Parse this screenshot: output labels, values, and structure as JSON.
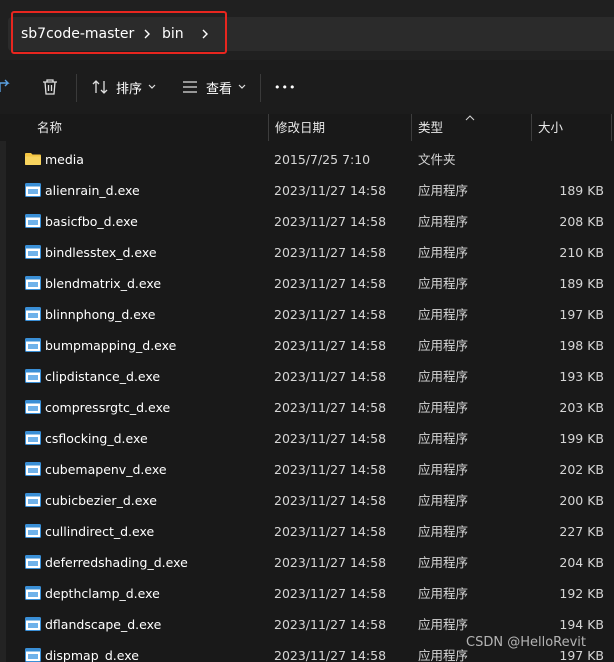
{
  "breadcrumb": {
    "items": [
      "sb7code-master",
      "bin"
    ]
  },
  "toolbar": {
    "sort_label": "排序",
    "view_label": "查看",
    "more_label": "•••"
  },
  "columns": {
    "name": "名称",
    "date": "修改日期",
    "type": "类型",
    "size": "大小"
  },
  "files": [
    {
      "name": "media",
      "date": "2015/7/25 7:10",
      "type": "文件夹",
      "size": "",
      "kind": "folder"
    },
    {
      "name": "alienrain_d.exe",
      "date": "2023/11/27 14:58",
      "type": "应用程序",
      "size": "189 KB",
      "kind": "exe"
    },
    {
      "name": "basicfbo_d.exe",
      "date": "2023/11/27 14:58",
      "type": "应用程序",
      "size": "208 KB",
      "kind": "exe"
    },
    {
      "name": "bindlesstex_d.exe",
      "date": "2023/11/27 14:58",
      "type": "应用程序",
      "size": "210 KB",
      "kind": "exe"
    },
    {
      "name": "blendmatrix_d.exe",
      "date": "2023/11/27 14:58",
      "type": "应用程序",
      "size": "189 KB",
      "kind": "exe"
    },
    {
      "name": "blinnphong_d.exe",
      "date": "2023/11/27 14:58",
      "type": "应用程序",
      "size": "197 KB",
      "kind": "exe"
    },
    {
      "name": "bumpmapping_d.exe",
      "date": "2023/11/27 14:58",
      "type": "应用程序",
      "size": "198 KB",
      "kind": "exe"
    },
    {
      "name": "clipdistance_d.exe",
      "date": "2023/11/27 14:58",
      "type": "应用程序",
      "size": "193 KB",
      "kind": "exe"
    },
    {
      "name": "compressrgtc_d.exe",
      "date": "2023/11/27 14:58",
      "type": "应用程序",
      "size": "203 KB",
      "kind": "exe"
    },
    {
      "name": "csflocking_d.exe",
      "date": "2023/11/27 14:58",
      "type": "应用程序",
      "size": "199 KB",
      "kind": "exe"
    },
    {
      "name": "cubemapenv_d.exe",
      "date": "2023/11/27 14:58",
      "type": "应用程序",
      "size": "202 KB",
      "kind": "exe"
    },
    {
      "name": "cubicbezier_d.exe",
      "date": "2023/11/27 14:58",
      "type": "应用程序",
      "size": "200 KB",
      "kind": "exe"
    },
    {
      "name": "cullindirect_d.exe",
      "date": "2023/11/27 14:58",
      "type": "应用程序",
      "size": "227 KB",
      "kind": "exe"
    },
    {
      "name": "deferredshading_d.exe",
      "date": "2023/11/27 14:58",
      "type": "应用程序",
      "size": "204 KB",
      "kind": "exe"
    },
    {
      "name": "depthclamp_d.exe",
      "date": "2023/11/27 14:58",
      "type": "应用程序",
      "size": "192 KB",
      "kind": "exe"
    },
    {
      "name": "dflandscape_d.exe",
      "date": "2023/11/27 14:58",
      "type": "应用程序",
      "size": "194 KB",
      "kind": "exe"
    },
    {
      "name": "dispmap_d.exe",
      "date": "2023/11/27 14:58",
      "type": "应用程序",
      "size": "197 KB",
      "kind": "exe"
    }
  ],
  "watermark": "CSDN @HelloRevit",
  "colors": {
    "background": "#191919",
    "highlight": "#e8261f",
    "folder": "#f4c542",
    "exe_icon": "#3a8fd6"
  }
}
